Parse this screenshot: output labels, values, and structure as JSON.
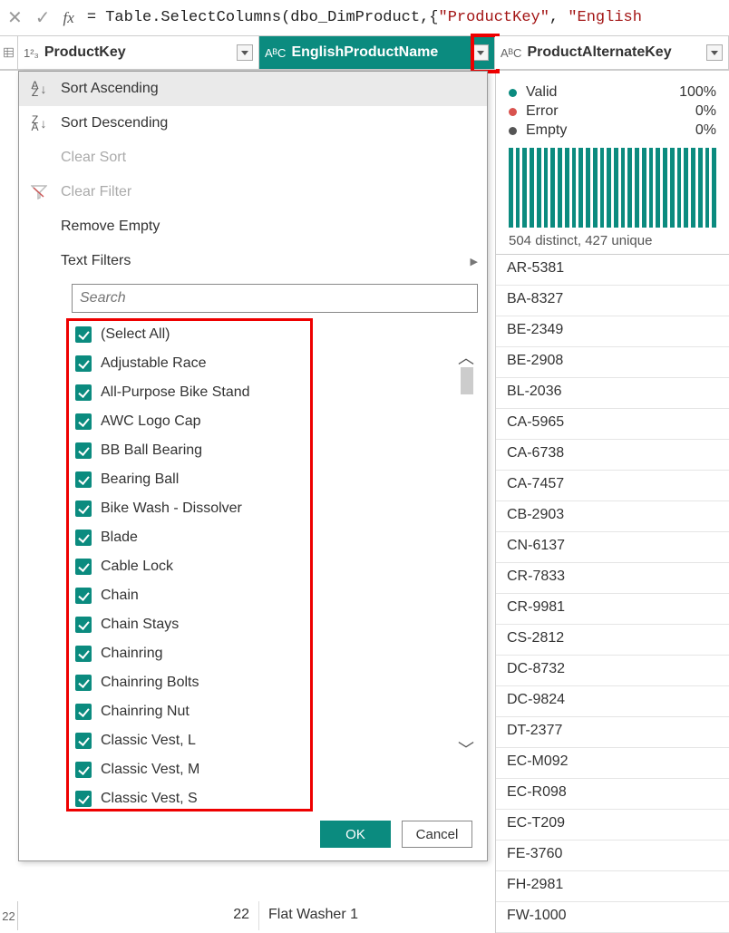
{
  "formula_bar": {
    "x": "✕",
    "check": "✓",
    "fx": "fx",
    "eq": "= ",
    "fn": "Table.SelectColumns",
    "open": "(",
    "arg1": "dbo_DimProduct",
    "comma1": ",{",
    "str1": "\"ProductKey\"",
    "comma2": ", ",
    "str2": "\"English"
  },
  "columns": {
    "product_key": {
      "type_label": "1²₃",
      "name": "ProductKey"
    },
    "english_name": {
      "type_label": "AᴮC",
      "name": "EnglishProductName"
    },
    "alt_key": {
      "type_label": "AᴮC",
      "name": "ProductAlternateKey"
    }
  },
  "menu": {
    "sort_asc": "Sort Ascending",
    "sort_desc": "Sort Descending",
    "clear_sort": "Clear Sort",
    "clear_filter": "Clear Filter",
    "remove_empty": "Remove Empty",
    "text_filters": "Text Filters",
    "search_placeholder": "Search",
    "ok": "OK",
    "cancel": "Cancel"
  },
  "filter_items": [
    "(Select All)",
    "Adjustable Race",
    "All-Purpose Bike Stand",
    "AWC Logo Cap",
    "BB Ball Bearing",
    "Bearing Ball",
    "Bike Wash - Dissolver",
    "Blade",
    "Cable Lock",
    "Chain",
    "Chain Stays",
    "Chainring",
    "Chainring Bolts",
    "Chainring Nut",
    "Classic Vest, L",
    "Classic Vest, M",
    "Classic Vest, S"
  ],
  "profile": {
    "valid_label": "Valid",
    "valid_pct": "100%",
    "error_label": "Error",
    "error_pct": "0%",
    "empty_label": "Empty",
    "empty_pct": "0%",
    "dist": "504 distinct, 427 unique"
  },
  "alt_key_values": [
    "AR-5381",
    "BA-8327",
    "BE-2349",
    "BE-2908",
    "BL-2036",
    "CA-5965",
    "CA-6738",
    "CA-7457",
    "CB-2903",
    "CN-6137",
    "CR-7833",
    "CR-9981",
    "CS-2812",
    "DC-8732",
    "DC-9824",
    "DT-2377",
    "EC-M092",
    "EC-R098",
    "EC-T209",
    "FE-3760",
    "FH-2981",
    "FW-1000"
  ],
  "visible_row": {
    "num": "22",
    "pk": "22",
    "name": "Flat Washer 1"
  }
}
